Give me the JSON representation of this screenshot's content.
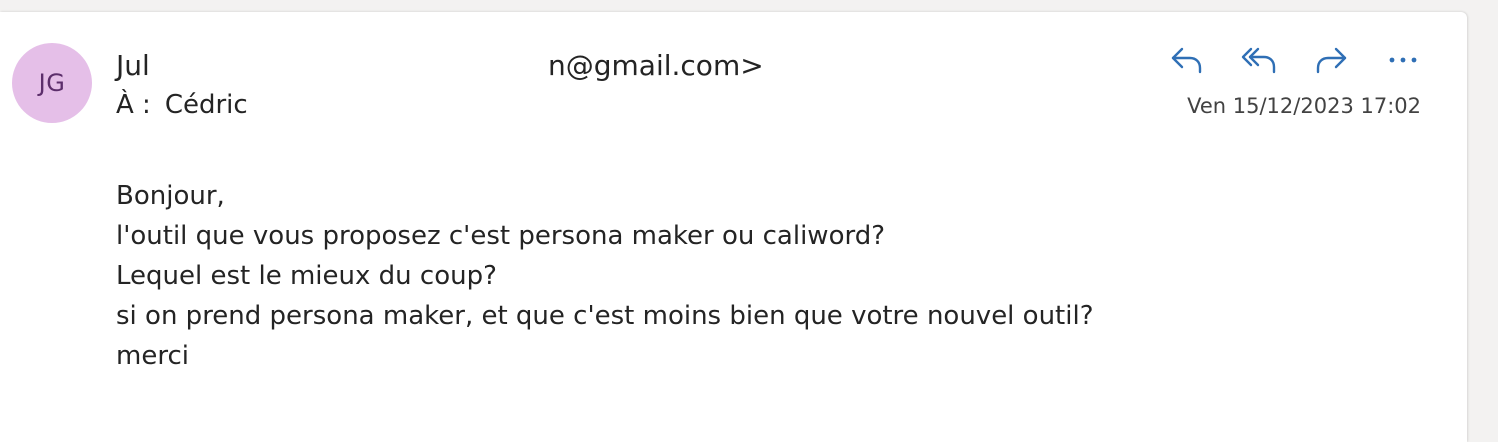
{
  "message": {
    "avatar_initials": "JG",
    "avatar_color": "#e5bfe8",
    "sender_name": "Jul",
    "sender_email": "n@gmail.com>",
    "to_label": "À :",
    "to_name": "Cédric",
    "date": "Ven 15/12/2023 17:02",
    "body": [
      "Bonjour,",
      "l'outil que vous proposez c'est persona maker ou caliword?",
      "Lequel est le mieux du coup?",
      "si on prend persona maker, et que c'est moins bien que votre nouvel outil?",
      "merci"
    ]
  },
  "actions": {
    "reply_icon": "reply-icon",
    "reply_all_icon": "reply-all-icon",
    "forward_icon": "forward-icon",
    "more_icon": "more-icon",
    "accent_color": "#2f6fb5"
  }
}
